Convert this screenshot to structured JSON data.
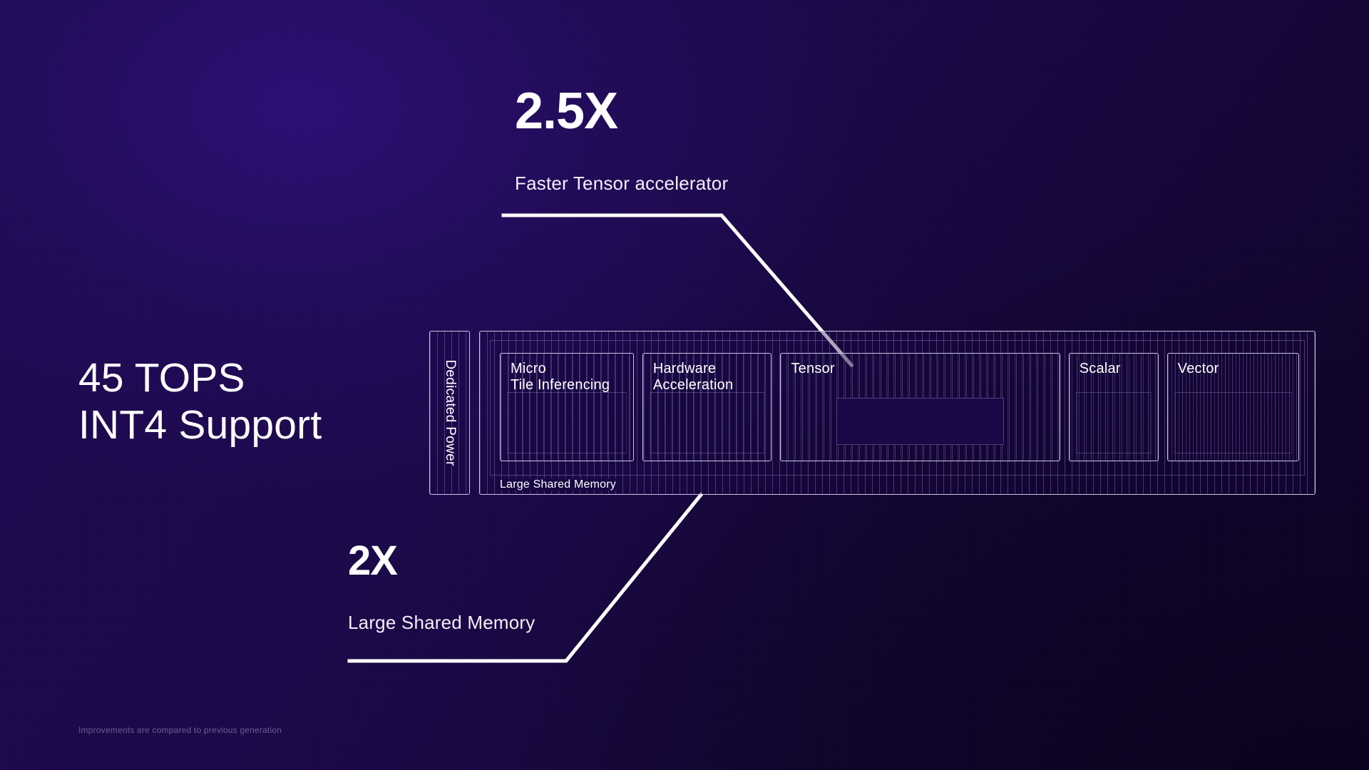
{
  "slide": {
    "headline_line1": "45 TOPS",
    "headline_line2": "INT4 Support",
    "headline": "45 TOPS\nINT4 Support",
    "footnote": "Improvements are compared to previous generation",
    "background_color": "#1a0847",
    "accent_color": "#cdc4e8",
    "text_color": "#ffffff"
  },
  "callouts": {
    "top": {
      "value": "2.5X",
      "description": "Faster Tensor accelerator"
    },
    "bottom": {
      "value": "2X",
      "description": "Large Shared Memory"
    }
  },
  "chip": {
    "power_strip_label": "Dedicated Power",
    "shared_memory_label": "Large Shared Memory",
    "units": [
      {
        "label": "Micro\nTile Inferencing",
        "width_flex": 150
      },
      {
        "label": "Hardware\nAcceleration",
        "width_flex": 145
      },
      {
        "label": "Tensor",
        "width_flex": 315,
        "wide": true
      },
      {
        "label": "Scalar",
        "width_flex": 100
      },
      {
        "label": "Vector",
        "width_flex": 148
      }
    ]
  }
}
